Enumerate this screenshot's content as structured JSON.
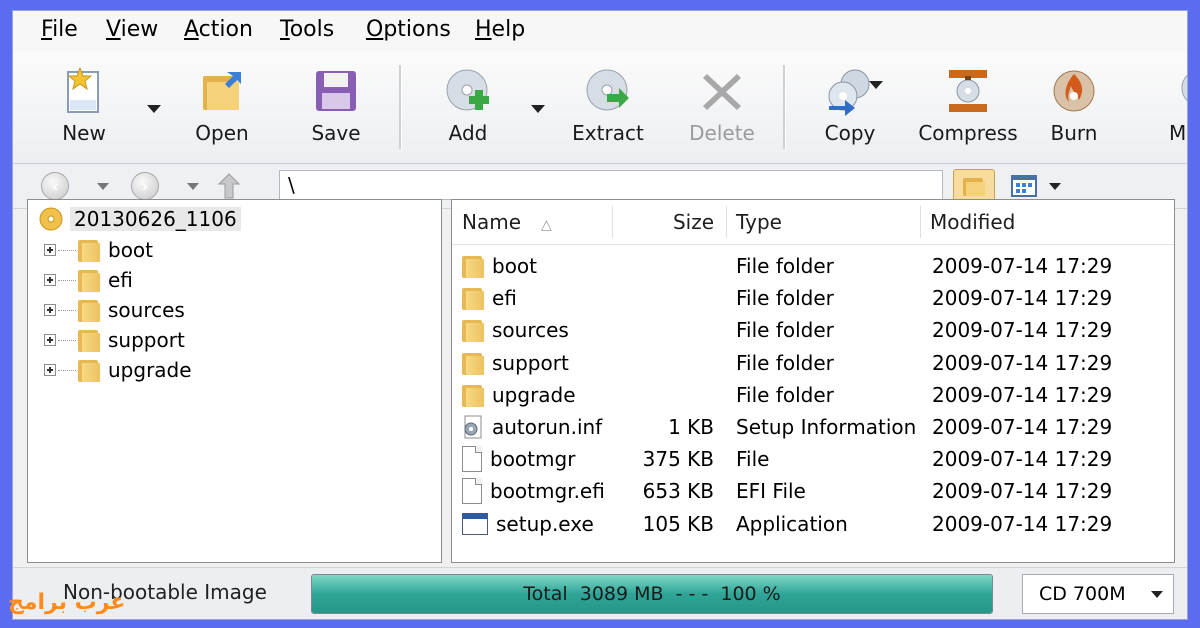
{
  "menu": [
    {
      "label": "File",
      "mnemonic": "F",
      "rest": "ile"
    },
    {
      "label": "View",
      "mnemonic": "V",
      "rest": "iew"
    },
    {
      "label": "Action",
      "mnemonic": "A",
      "rest": "ction"
    },
    {
      "label": "Tools",
      "mnemonic": "T",
      "rest": "ools"
    },
    {
      "label": "Options",
      "mnemonic": "O",
      "rest": "ptions"
    },
    {
      "label": "Help",
      "mnemonic": "H",
      "rest": "elp"
    }
  ],
  "toolbar": {
    "new": "New",
    "open": "Open",
    "save": "Save",
    "add": "Add",
    "extract": "Extract",
    "delete": "Delete",
    "copy": "Copy",
    "compress": "Compress",
    "burn": "Burn",
    "more": "M"
  },
  "address": {
    "path": "\\"
  },
  "tree": {
    "root": "20130626_1106",
    "items": [
      "boot",
      "efi",
      "sources",
      "support",
      "upgrade"
    ]
  },
  "list": {
    "columns": {
      "name": "Name",
      "size": "Size",
      "type": "Type",
      "modified": "Modified"
    },
    "rows": [
      {
        "name": "boot",
        "size": "",
        "type": "File folder",
        "modified": "2009-07-14 17:29",
        "icon": "folder-icon"
      },
      {
        "name": "efi",
        "size": "",
        "type": "File folder",
        "modified": "2009-07-14 17:29",
        "icon": "folder-icon"
      },
      {
        "name": "sources",
        "size": "",
        "type": "File folder",
        "modified": "2009-07-14 17:29",
        "icon": "folder-icon"
      },
      {
        "name": "support",
        "size": "",
        "type": "File folder",
        "modified": "2009-07-14 17:29",
        "icon": "folder-icon"
      },
      {
        "name": "upgrade",
        "size": "",
        "type": "File folder",
        "modified": "2009-07-14 17:29",
        "icon": "folder-icon"
      },
      {
        "name": "autorun.inf",
        "size": "1 KB",
        "type": "Setup Information",
        "modified": "2009-07-14 17:29",
        "icon": "settings-file-icon"
      },
      {
        "name": "bootmgr",
        "size": "375 KB",
        "type": "File",
        "modified": "2009-07-14 17:29",
        "icon": "file-icon"
      },
      {
        "name": "bootmgr.efi",
        "size": "653 KB",
        "type": "EFI File",
        "modified": "2009-07-14 17:29",
        "icon": "file-icon"
      },
      {
        "name": "setup.exe",
        "size": "105 KB",
        "type": "Application",
        "modified": "2009-07-14 17:29",
        "icon": "application-icon"
      }
    ]
  },
  "status": {
    "image_type": "Non-bootable Image",
    "progress_text": "Total  3089 MB  - - -  100 %",
    "progress_fraction": 1.0,
    "media": "CD 700M"
  },
  "watermark": "عرب برامج",
  "colors": {
    "background": "#5b6cf0",
    "progress_fill": "#2fa597",
    "watermark": "#ff8c1a"
  }
}
